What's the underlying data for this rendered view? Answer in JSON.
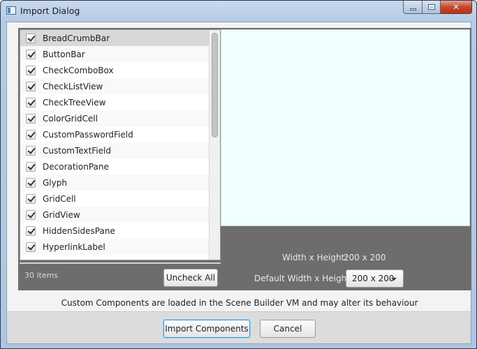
{
  "window": {
    "title": "Import Dialog"
  },
  "list": {
    "items": [
      {
        "label": "BreadCrumbBar",
        "checked": true,
        "selected": true
      },
      {
        "label": "ButtonBar",
        "checked": true
      },
      {
        "label": "CheckComboBox",
        "checked": true
      },
      {
        "label": "CheckListView",
        "checked": true
      },
      {
        "label": "CheckTreeView",
        "checked": true
      },
      {
        "label": "ColorGridCell",
        "checked": true
      },
      {
        "label": "CustomPasswordField",
        "checked": true
      },
      {
        "label": "CustomTextField",
        "checked": true
      },
      {
        "label": "DecorationPane",
        "checked": true
      },
      {
        "label": "Glyph",
        "checked": true
      },
      {
        "label": "GridCell",
        "checked": true
      },
      {
        "label": "GridView",
        "checked": true
      },
      {
        "label": "HiddenSidesPane",
        "checked": true
      },
      {
        "label": "HyperlinkLabel",
        "checked": true
      }
    ],
    "count_label": "30 items",
    "uncheck_all_label": "Uncheck All"
  },
  "preview": {
    "width_height_label": "Width x Height:",
    "width_height_value": "200 x 200",
    "default_size_label": "Default Width x Height:",
    "default_size_selected": "200 x 200",
    "background_color": "#f0ffff"
  },
  "note": "Custom Components are loaded in the Scene Builder VM and may alter its behaviour",
  "buttons": {
    "import_label": "Import Components",
    "cancel_label": "Cancel"
  }
}
